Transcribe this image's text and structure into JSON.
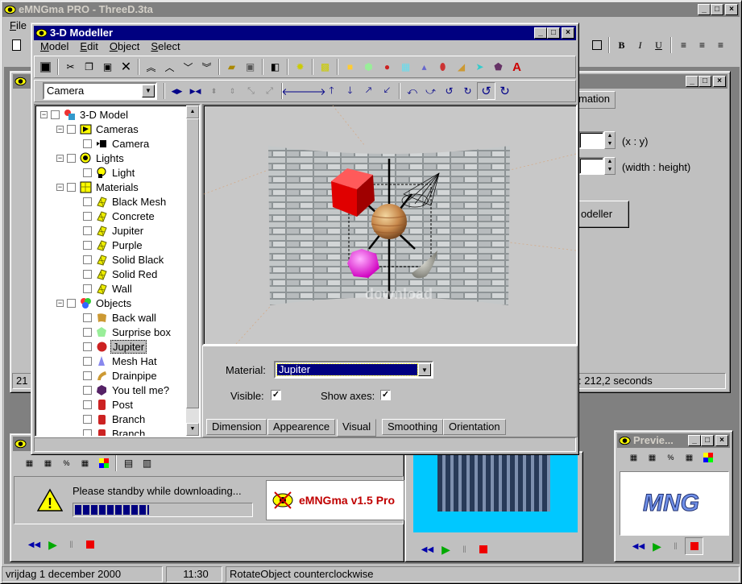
{
  "main_window": {
    "title": "eMNGma PRO - ThreeD.3ta",
    "menu_file": "File"
  },
  "modeller": {
    "title": "3-D Modeller",
    "menu": [
      "Model",
      "Edit",
      "Object",
      "Select"
    ],
    "camera_select": "Camera",
    "tree": [
      {
        "label": "3-D Model",
        "icon": "model-icon",
        "level": 0,
        "expander": "−"
      },
      {
        "label": "Cameras",
        "icon": "cameras-icon",
        "level": 1,
        "expander": "−"
      },
      {
        "label": "Camera",
        "icon": "camera-icon",
        "level": 2
      },
      {
        "label": "Lights",
        "icon": "lights-icon",
        "level": 1,
        "expander": "−"
      },
      {
        "label": "Light",
        "icon": "light-icon",
        "level": 2
      },
      {
        "label": "Materials",
        "icon": "materials-icon",
        "level": 1,
        "expander": "−"
      },
      {
        "label": "Black Mesh",
        "icon": "material-icon",
        "level": 2
      },
      {
        "label": "Concrete",
        "icon": "material-icon",
        "level": 2
      },
      {
        "label": "Jupiter",
        "icon": "material-icon",
        "level": 2
      },
      {
        "label": "Purple",
        "icon": "material-icon",
        "level": 2
      },
      {
        "label": "Solid Black",
        "icon": "material-icon",
        "level": 2
      },
      {
        "label": "Solid Red",
        "icon": "material-icon",
        "level": 2
      },
      {
        "label": "Wall",
        "icon": "material-icon",
        "level": 2
      },
      {
        "label": "Objects",
        "icon": "objects-icon",
        "level": 1,
        "expander": "−"
      },
      {
        "label": "Back wall",
        "icon": "backwall-icon",
        "level": 2
      },
      {
        "label": "Surprise box",
        "icon": "box-icon",
        "level": 2
      },
      {
        "label": "Jupiter",
        "icon": "sphere-icon",
        "level": 2,
        "selected": true
      },
      {
        "label": "Mesh Hat",
        "icon": "cone-icon",
        "level": 2
      },
      {
        "label": "Drainpipe",
        "icon": "pipe-icon",
        "level": 2
      },
      {
        "label": "You tell me?",
        "icon": "blob-icon",
        "level": 2
      },
      {
        "label": "Post",
        "icon": "post-icon",
        "level": 2
      },
      {
        "label": "Branch",
        "icon": "branch-icon",
        "level": 2
      },
      {
        "label": "Branch",
        "icon": "branch-icon",
        "level": 2
      }
    ],
    "props": {
      "material_label": "Material:",
      "material_value": "Jupiter",
      "visible_label": "Visible:",
      "show_axes_label": "Show axes:",
      "visible_check": "✓",
      "axes_check": "✓"
    },
    "tabs": [
      "Dimension",
      "Appearence",
      "Visual",
      "Smoothing",
      "Orientation"
    ],
    "active_tab": "Visual",
    "watermark": "download"
  },
  "bg_window": {
    "tab_label": "mation",
    "xy_label": "(x : y)",
    "wh_label": "(width : height)",
    "button_label": "odeller",
    "status_num": "21",
    "status_seconds": ": 212,2 seconds"
  },
  "download": {
    "message": "Please standby while downloading...",
    "progress": 0.42,
    "warning_glyph": "!",
    "banner": "eMNGma v1.5 Pro"
  },
  "preview": {
    "title": "Previe...",
    "logo": "MNG"
  },
  "statusbar": {
    "date": "vrijdag 1 december 2000",
    "time": "11:30",
    "action": "RotateObject counterclockwise"
  },
  "colors": {
    "title_active": "#000080",
    "title_inactive": "#808080",
    "face": "#c0c0c0",
    "selection": "#000080",
    "cyan": "#00c8ff"
  }
}
